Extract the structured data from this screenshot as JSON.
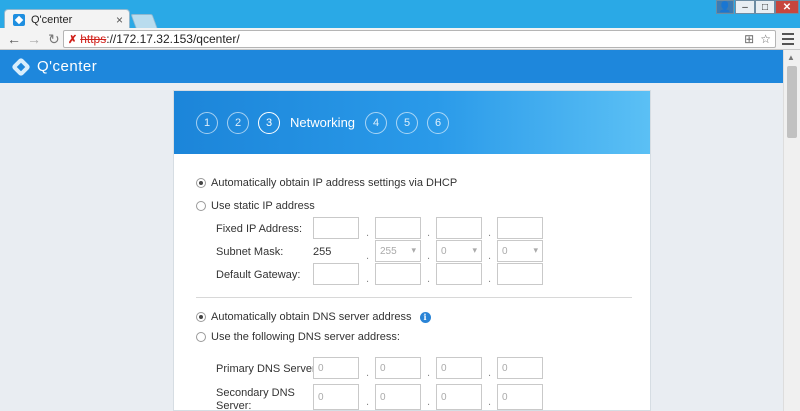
{
  "browser": {
    "tab_title": "Q'center",
    "tab_close": "×",
    "url_scheme": "https",
    "url_rest": "://172.17.32.153/qcenter/",
    "window_buttons": {
      "user": "👤",
      "minimize": "–",
      "maximize": "□",
      "close": "✕"
    }
  },
  "app": {
    "logo_text": "Q'center"
  },
  "wizard": {
    "steps": [
      "1",
      "2",
      "3",
      "4",
      "5",
      "6"
    ],
    "active_step": "3",
    "active_title": "Networking"
  },
  "ip_settings": {
    "dhcp_label": "Automatically obtain IP address settings via DHCP",
    "dhcp_checked": true,
    "static_label": "Use static IP address",
    "fixed_ip_label": "Fixed IP Address:",
    "fixed_ip_values": [
      "",
      "",
      "",
      ""
    ],
    "subnet_label": "Subnet Mask:",
    "subnet_first": "255",
    "subnet_values": [
      "255",
      "0",
      "0"
    ],
    "gateway_label": "Default Gateway:",
    "gateway_values": [
      "",
      "",
      "",
      ""
    ]
  },
  "dns_settings": {
    "auto_label": "Automatically obtain DNS server address",
    "auto_checked": true,
    "manual_label": "Use the following DNS server address:",
    "primary_label": "Primary DNS Server:",
    "primary_values": [
      "0",
      "0",
      "0",
      "0"
    ],
    "secondary_label": "Secondary DNS Server:",
    "secondary_values": [
      "0",
      "0",
      "0",
      "0"
    ]
  },
  "separator": ".",
  "colors": {
    "accent": "#1e87dc",
    "header_end": "#5bc0f5",
    "chrome": "#2aa9e6"
  }
}
